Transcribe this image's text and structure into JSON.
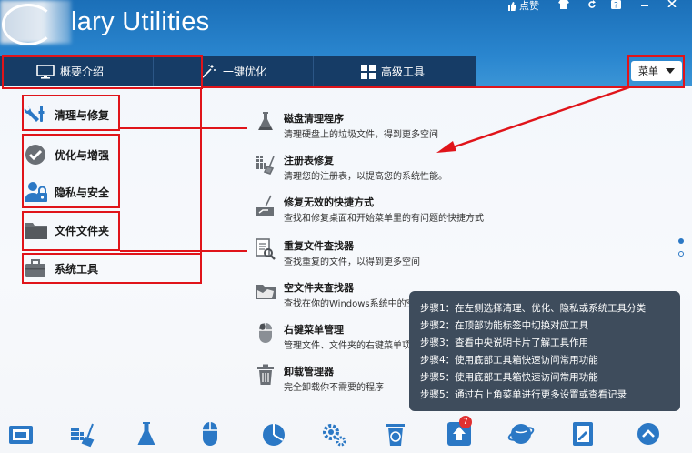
{
  "app": {
    "title": "lary Utilities",
    "top_controls": [
      "点赞"
    ]
  },
  "nav": {
    "tabs": [
      {
        "label": "概要介绍",
        "icon": "monitor-icon"
      },
      {
        "label": "一键优化",
        "icon": "magic-wand-icon"
      },
      {
        "label": "高级工具",
        "icon": "grid-icon"
      }
    ],
    "menu_label": "菜单"
  },
  "sidebar": {
    "items": [
      {
        "label": "清理与修复",
        "icon": "wrench-icon"
      },
      {
        "label": "优化与增强",
        "icon": "checkmark-icon"
      },
      {
        "label": "隐私与安全",
        "icon": "user-lock-icon"
      },
      {
        "label": "文件文件夹",
        "icon": "folder-icon"
      },
      {
        "label": "系统工具",
        "icon": "briefcase-icon"
      }
    ]
  },
  "tools": [
    {
      "name": "磁盘清理程序",
      "desc": "清理硬盘上的垃圾文件，得到更多空间",
      "icon": "flask-icon"
    },
    {
      "name": "注册表修复",
      "desc": "清理您的注册表，以提高您的系统性能。",
      "icon": "registry-broom-icon"
    },
    {
      "name": "修复无效的快捷方式",
      "desc": "查找和修复桌面和开始菜单里的有问题的快捷方式",
      "icon": "shortcut-broom-icon"
    },
    {
      "name": "重复文件查找器",
      "desc": "查找重复的文件，以得到更多空间",
      "icon": "duplicate-search-icon"
    },
    {
      "name": "空文件夹查找器",
      "desc": "查找在你的Windows系统中的空文件夹",
      "icon": "empty-folder-icon"
    },
    {
      "name": "右键菜单管理",
      "desc": "管理文件、文件夹的右键菜单项",
      "icon": "mouse-icon"
    },
    {
      "name": "卸载管理器",
      "desc": "完全卸载你不需要的程序",
      "icon": "trash-icon"
    }
  ],
  "tooltip": {
    "lines": [
      "步骤1：在左侧选择清理、优化、隐私或系统工具分类",
      "步骤2：在顶部功能标签中切换对应工具",
      "步骤3：查看中央说明卡片了解工具作用",
      "步骤4：使用底部工具箱快速访问常用功能",
      "步骤5：使用底部工具箱快速访问常用功能",
      "步骤5：通过右上角菜单进行更多设置或查看记录"
    ]
  },
  "bottom_toolbar": {
    "icons": [
      "disk-icon",
      "registry-icon",
      "flask-icon",
      "mouse-icon",
      "pie-chart-icon",
      "gears-icon",
      "recycle-trash-icon",
      "upload-icon",
      "globe-icon",
      "note-icon",
      "chevron-up-icon"
    ],
    "badge_count": "7"
  },
  "colors": {
    "titlebar": "#1b6fb8",
    "navbar": "#163c66",
    "annotation_red": "#e0141a",
    "tooltip_bg": "#3e4c5c"
  }
}
